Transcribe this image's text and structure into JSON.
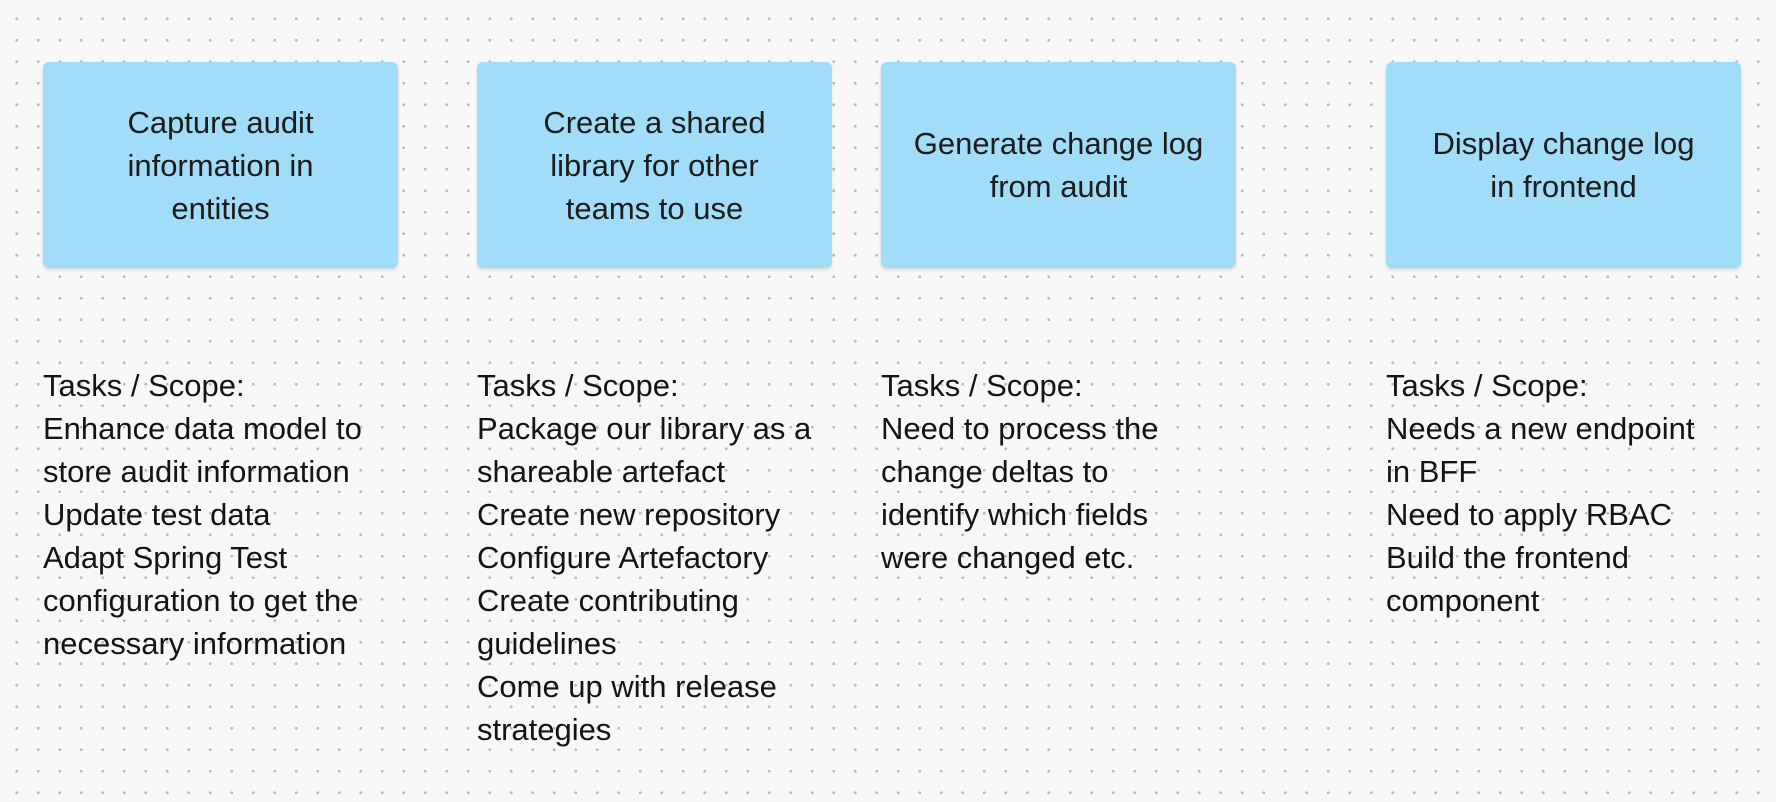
{
  "columns": [
    {
      "card": "Capture audit\ninformation in\nentities",
      "heading": "Tasks / Scope:",
      "tasks": [
        "Enhance data model to\nstore audit information",
        "Update test data",
        "Adapt Spring Test\nconfiguration to get the\nnecessary information"
      ]
    },
    {
      "card": "Create a shared\nlibrary for other\nteams to use",
      "heading": "Tasks / Scope:",
      "tasks": [
        "Package our library as a\nshareable artefact",
        "Create new repository",
        "Configure Artefactory",
        "Create contributing\nguidelines",
        "Come up with release\nstrategies"
      ]
    },
    {
      "card": "Generate change log\nfrom audit",
      "heading": "Tasks / Scope:",
      "tasks": [
        "Need to process the\nchange deltas to\nidentify which fields\nwere changed etc."
      ]
    },
    {
      "card": "Display change log\nin frontend",
      "heading": "Tasks / Scope:",
      "tasks": [
        "Needs a new endpoint\nin BFF",
        "Need to apply RBAC",
        "Build the frontend\ncomponent"
      ]
    }
  ],
  "colors": {
    "sticky": "#a1ddf8",
    "canvas": "#f7f7f7",
    "dots": "#b9b9b9"
  }
}
